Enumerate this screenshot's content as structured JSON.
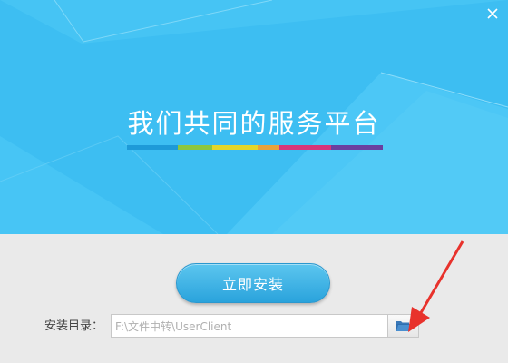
{
  "banner": {
    "headline": "我们共同的服务平台",
    "color_bar": [
      "#1e9ad8",
      "#8cc63f",
      "#e2d62a",
      "#e8a23a",
      "#d6357a",
      "#6a3fa0"
    ]
  },
  "icons": {
    "close": "close-icon",
    "folder": "folder-open-icon",
    "arrow": "red-arrow-annotation"
  },
  "install": {
    "button_label": "立即安装"
  },
  "directory": {
    "label": "安装目录：",
    "value": "F:\\文件中转\\UserClient"
  },
  "colors": {
    "banner_bg": "#3dbef2",
    "accent": "#2aa3dc",
    "annotation": "#e8322c"
  }
}
